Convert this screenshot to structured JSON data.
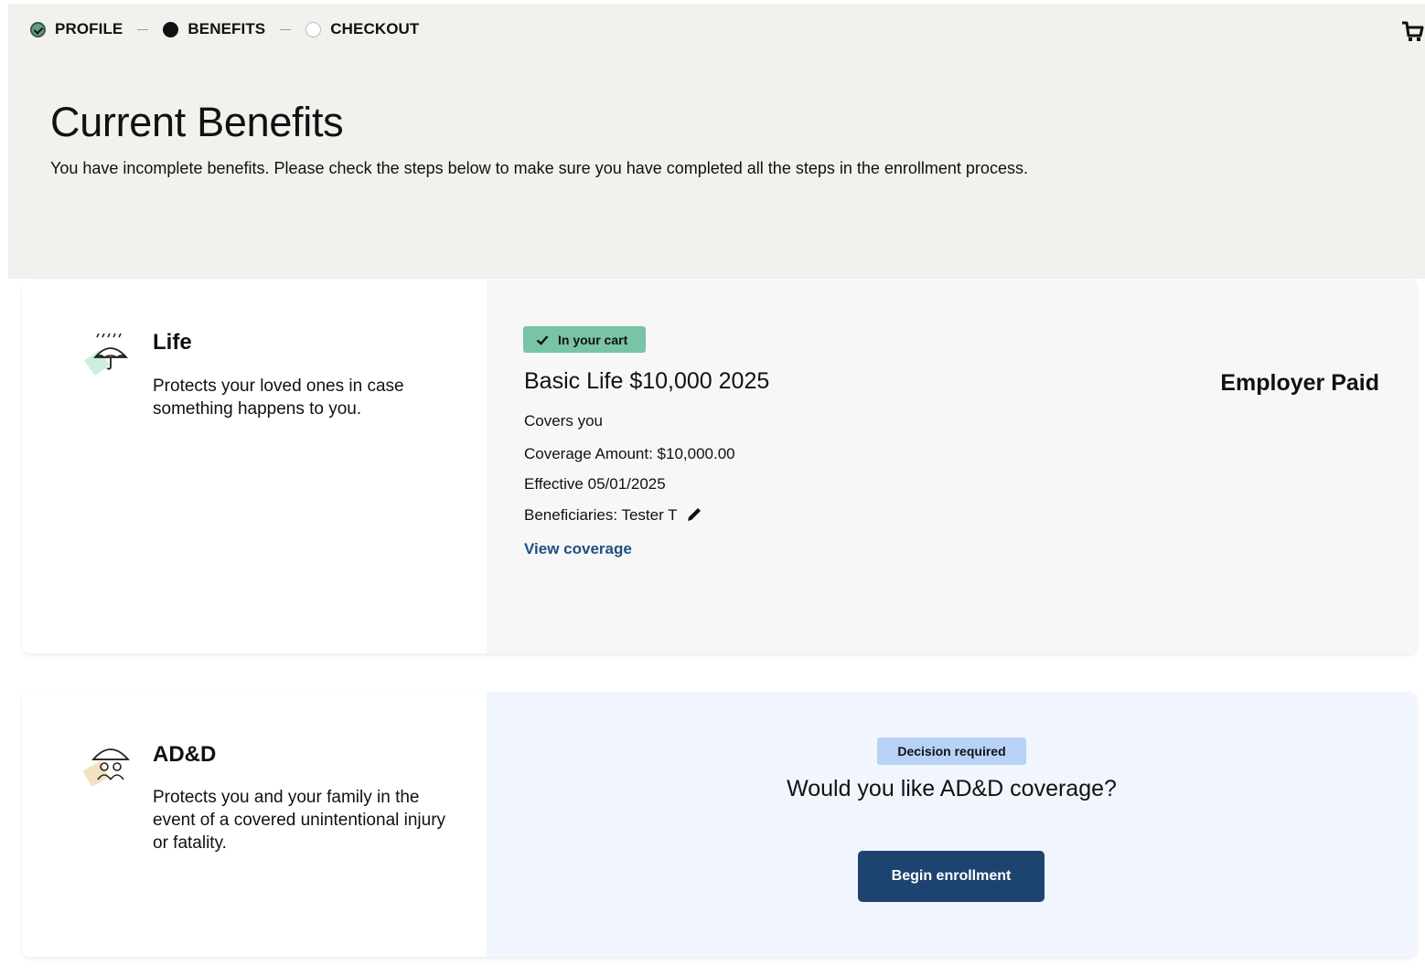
{
  "stepper": {
    "steps": [
      {
        "label": "PROFILE",
        "state": "complete"
      },
      {
        "label": "BENEFITS",
        "state": "current"
      },
      {
        "label": "CHECKOUT",
        "state": "upcoming"
      }
    ]
  },
  "header": {
    "title": "Current Benefits",
    "subtitle": "You have incomplete benefits. Please check the steps below to make sure you have completed all the steps in the enrollment process.",
    "cart_icon": "shopping-cart-icon"
  },
  "benefits": [
    {
      "name": "Life",
      "icon": "umbrella-rain-icon",
      "description": "Protects your loved ones in case something happens to you.",
      "status_badge": "In your cart",
      "plan_title": "Basic Life $10,000 2025",
      "covers": "Covers you",
      "coverage_amount": "Coverage Amount: $10,000.00",
      "effective": "Effective 05/01/2025",
      "beneficiaries": "Beneficiaries: Tester T",
      "link": "View coverage",
      "cost_label": "Employer Paid"
    },
    {
      "name": "AD&D",
      "icon": "umbrella-family-icon",
      "description": "Protects you and your family in the event of a covered unintentional injury or fatality.",
      "status_badge": "Decision required",
      "question": "Would you like AD&D coverage?",
      "action": "Begin enrollment"
    }
  ],
  "colors": {
    "header_bg": "#f3f1ed",
    "cart_badge": "#79c3a7",
    "decision_badge": "#b8d2f7",
    "primary_button": "#1d4471",
    "link": "#214f80"
  }
}
